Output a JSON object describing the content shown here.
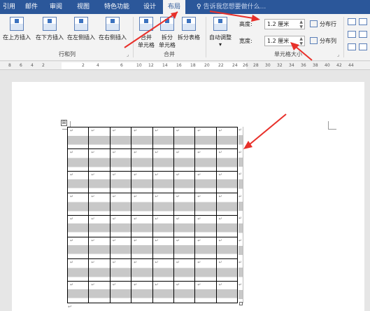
{
  "tabs": [
    {
      "id": "references",
      "label": "引用"
    },
    {
      "id": "mailings",
      "label": "邮件"
    },
    {
      "id": "review",
      "label": "审阅"
    },
    {
      "id": "view",
      "label": "视图"
    },
    {
      "id": "special",
      "label": "特色功能"
    },
    {
      "id": "design",
      "label": "设计"
    },
    {
      "id": "layout",
      "label": "布局",
      "active": true
    }
  ],
  "tellme": "告诉我您想要做什么...",
  "ribbon": {
    "insert_above": "在上方插入",
    "insert_below": "在下方插入",
    "insert_left": "在左侧插入",
    "insert_right": "在右侧插入",
    "rows_cols_group": "行和列",
    "merge_cells_1": "合并",
    "merge_cells_2": "单元格",
    "split_cells_1": "拆分",
    "split_cells_2": "单元格",
    "split_table": "拆分表格",
    "merge_group": "合并",
    "autofit": "自动调整",
    "height_label": "高度:",
    "height_value": "1.2 厘米",
    "width_label": "宽度:",
    "width_value": "1.2 厘米",
    "distribute_rows": "分布行",
    "distribute_cols": "分布列",
    "cell_size_group": "单元格大小"
  },
  "ruler_numbers": [
    "8",
    "6",
    "4",
    "2",
    "2",
    "4",
    "6",
    "10",
    "12",
    "14",
    "16",
    "18",
    "20",
    "22",
    "24",
    "26",
    "28",
    "30",
    "32",
    "34",
    "36",
    "38",
    "40",
    "42",
    "44"
  ],
  "paragraph_mark": "↵",
  "table_handle": "⊞",
  "colors": {
    "title_bar": "#2b579a",
    "arrow": "#e8302a"
  }
}
